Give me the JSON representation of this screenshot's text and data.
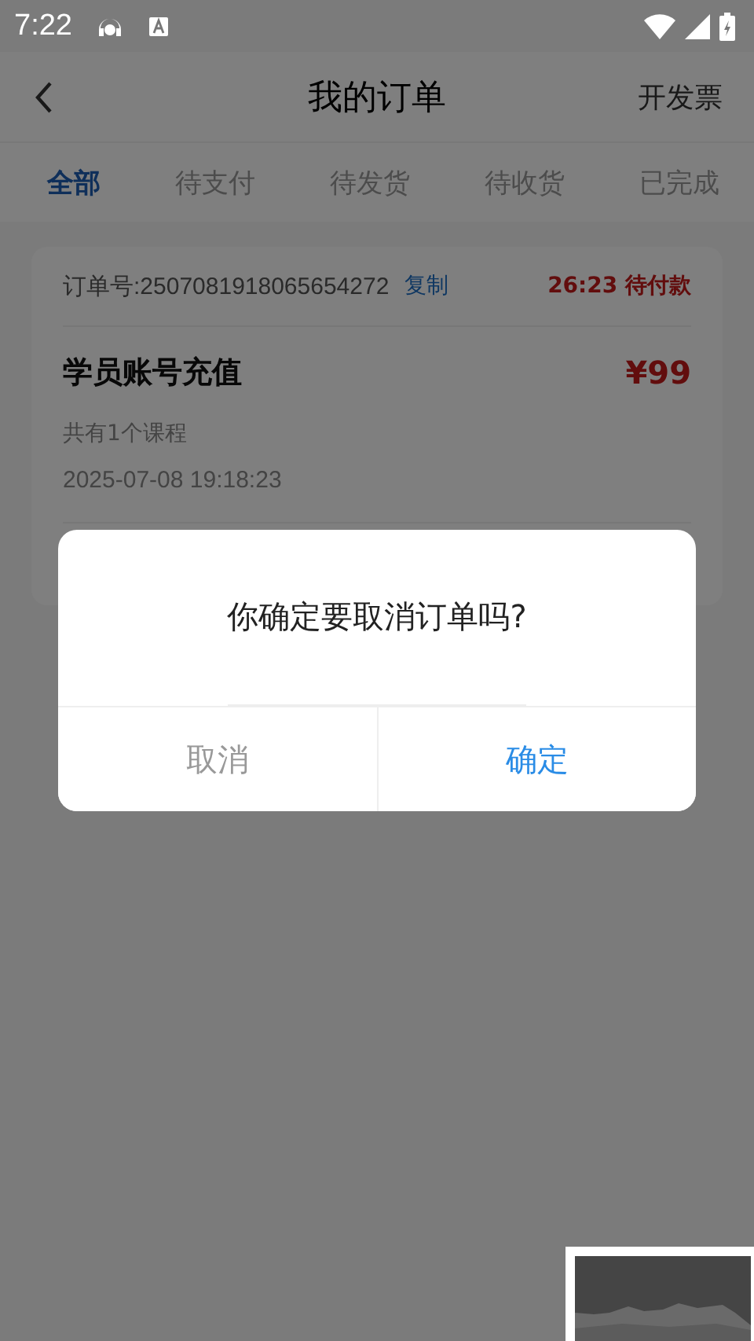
{
  "status_bar": {
    "time": "7:22"
  },
  "header": {
    "title": "我的订单",
    "action": "开发票"
  },
  "tabs": [
    {
      "label": "全部",
      "selected": true
    },
    {
      "label": "待支付",
      "selected": false
    },
    {
      "label": "待发货",
      "selected": false
    },
    {
      "label": "待收货",
      "selected": false
    },
    {
      "label": "已完成",
      "selected": false
    }
  ],
  "orders": [
    {
      "order_number": "订单号:2507081918065654272",
      "copy": "复制",
      "status": "26:23 待付款",
      "title": "学员账号充值",
      "price": "¥99",
      "course_count": "共有1个课程",
      "created": "2025-07-08 19:18:23"
    }
  ],
  "dialog": {
    "message": "你确定要取消订单吗?",
    "buttons": [
      {
        "label": "取消",
        "kind": "cancel"
      },
      {
        "label": "确定",
        "kind": "confirm"
      }
    ]
  }
}
